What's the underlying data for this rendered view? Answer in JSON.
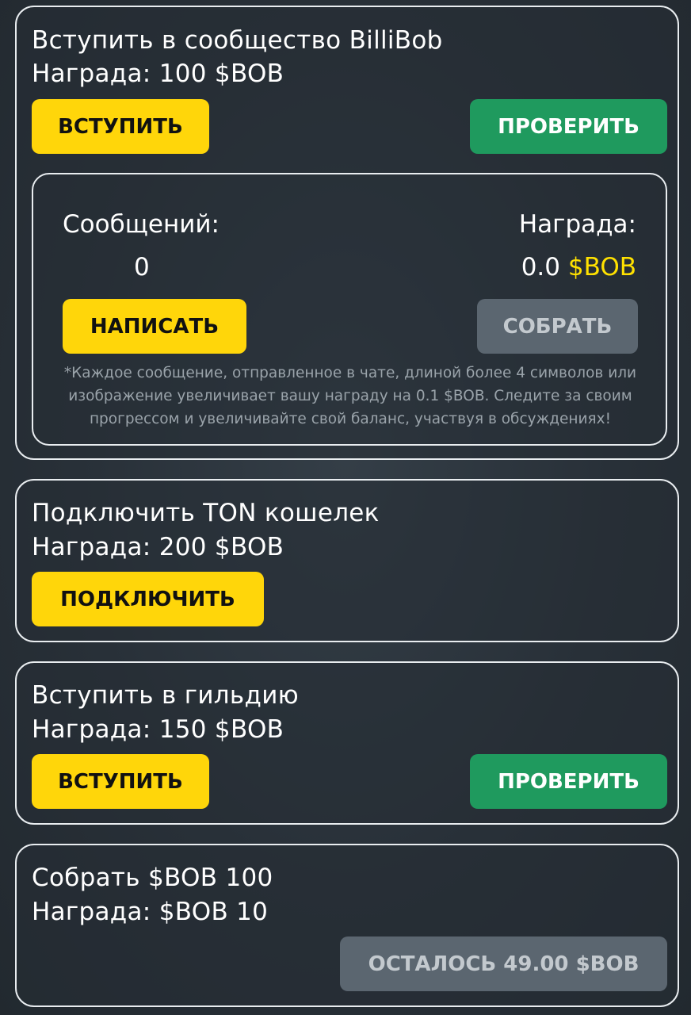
{
  "colors": {
    "accent_yellow": "#ffd60a",
    "accent_green": "#1f9a5e",
    "disabled_gray": "#5b6670",
    "highlight_text": "#ffe100",
    "card_border": "#e9edf0"
  },
  "tasks": [
    {
      "title": "Вступить в сообщество BilliBob",
      "reward": "Награда: 100 $BOB",
      "primary_label": "ВСТУПИТЬ",
      "check_label": "ПРОВЕРИТЬ",
      "chat": {
        "messages_label": "Сообщений:",
        "messages_value": "0",
        "reward_label": "Награда:",
        "reward_value": "0.0",
        "reward_currency": "$BOB",
        "write_label": "НАПИСАТЬ",
        "collect_label": "СОБРАТЬ",
        "note": "*Каждое сообщение, отправленное в чате, длиной более 4 символов или изображение увеличивает вашу награду на 0.1 $BOB. Следите за своим прогрессом и увеличивайте свой баланс, участвуя в обсуждениях!"
      }
    },
    {
      "title": "Подключить TON кошелек",
      "reward": "Награда: 200 $BOB",
      "primary_label": "ПОДКЛЮЧИТЬ"
    },
    {
      "title": "Вступить в гильдию",
      "reward": "Награда: 150 $BOB",
      "primary_label": "ВСТУПИТЬ",
      "check_label": "ПРОВЕРИТЬ"
    },
    {
      "title": "Собрать $BOB 100",
      "reward": "Награда: $BOB 10",
      "remaining_label": "ОСТАЛОСЬ 49.00 $BOB"
    }
  ]
}
